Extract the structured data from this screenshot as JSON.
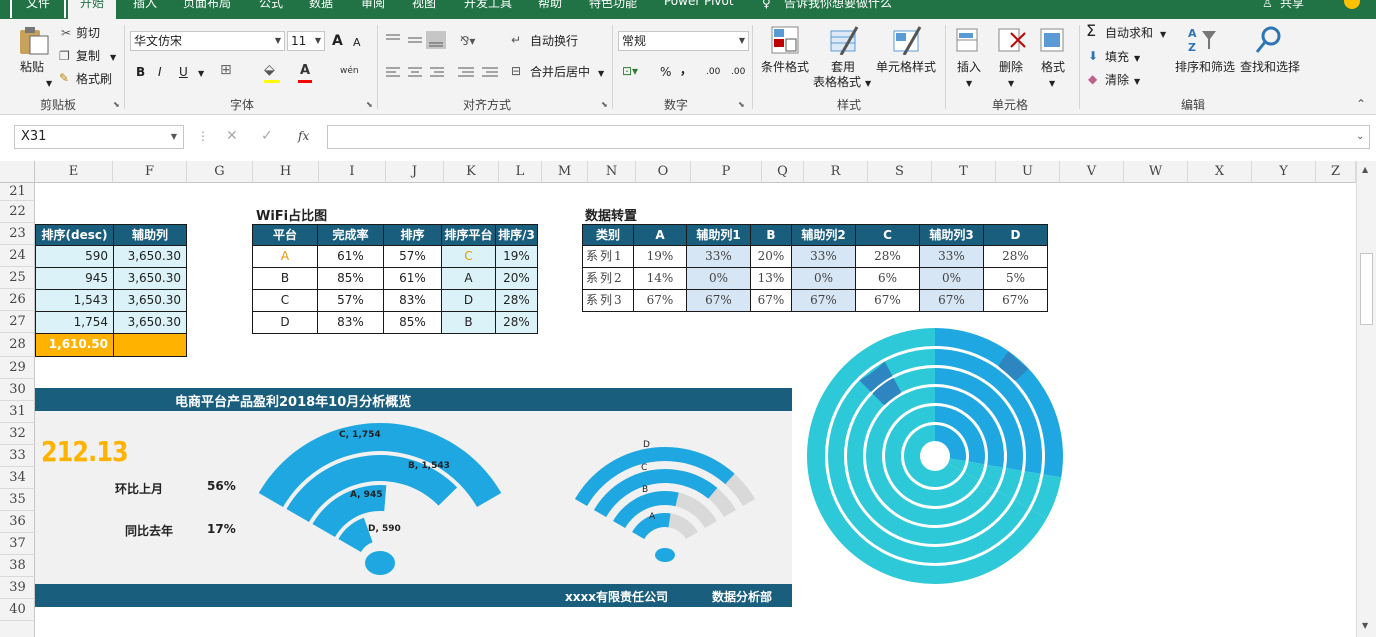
{
  "tabs": {
    "file": "文件",
    "home": "开始",
    "insert": "插入",
    "layout": "页面布局",
    "formulas": "公式",
    "data": "数据",
    "review": "审阅",
    "view": "视图",
    "developer": "开发工具",
    "help": "帮助",
    "special": "特色功能",
    "powerpivot": "Power Pivot",
    "tell": "告诉我你想要做什么",
    "share": "共享"
  },
  "ribbon": {
    "paste": "粘贴",
    "cut": "剪切",
    "copy": "复制",
    "format_painter": "格式刷",
    "clipboard": "剪贴板",
    "font_name": "华文仿宋",
    "font_size": "11",
    "font_group": "字体",
    "wrap": "自动换行",
    "merge": "合并后居中",
    "align_group": "对齐方式",
    "num_format": "常规",
    "num_group": "数字",
    "cond_format": "条件格式",
    "table_format_1": "套用",
    "table_format_2": "表格格式",
    "cell_style": "单元格样式",
    "style_group": "样式",
    "insert": "插入",
    "delete": "删除",
    "format": "格式",
    "cells_group": "单元格",
    "autosum": "自动求和",
    "fill": "填充",
    "clear": "清除",
    "sort_filter": "排序和筛选",
    "find": "查找和选择",
    "edit_group": "编辑",
    "bold": "B",
    "italic": "I",
    "underline": "U",
    "bigA": "A",
    "smallA": "A",
    "wen": "wén",
    "pct": "%",
    "comma": "，",
    "dec_inc": ".00",
    "dec_dec": ".00"
  },
  "namebox": "X31",
  "fx": "fx",
  "columns": [
    "E",
    "F",
    "G",
    "H",
    "I",
    "J",
    "K",
    "L",
    "M",
    "N",
    "O",
    "P",
    "Q",
    "R",
    "S",
    "T",
    "U",
    "V",
    "W",
    "X",
    "Y",
    "Z"
  ],
  "rows": [
    "21",
    "22",
    "23",
    "24",
    "25",
    "26",
    "27",
    "28",
    "29",
    "30",
    "31",
    "32",
    "33",
    "34",
    "35",
    "36",
    "37",
    "38",
    "39",
    "40"
  ],
  "t1": {
    "h1": "排序(desc)",
    "h2": "辅助列",
    "r1a": "590",
    "r1b": "3,650.30",
    "r2a": "945",
    "r2b": "3,650.30",
    "r3a": "1,543",
    "r3b": "3,650.30",
    "r4a": "1,754",
    "r4b": "3,650.30",
    "total": "1,610.50"
  },
  "t2": {
    "title": "WiFi占比图",
    "h1": "平台",
    "h2": "完成率",
    "h3": "排序",
    "h4": "排序平台",
    "h5": "排序/3",
    "rows": [
      [
        "A",
        "61%",
        "57%",
        "C",
        "19%"
      ],
      [
        "B",
        "85%",
        "61%",
        "A",
        "20%"
      ],
      [
        "C",
        "57%",
        "83%",
        "D",
        "28%"
      ],
      [
        "D",
        "83%",
        "85%",
        "B",
        "28%"
      ]
    ]
  },
  "t3": {
    "title": "数据转置",
    "h": [
      "类别",
      "A",
      "辅助列1",
      "B",
      "辅助列2",
      "C",
      "辅助列3",
      "D"
    ],
    "rows": [
      [
        "系列1",
        "19%",
        "33%",
        "20%",
        "33%",
        "28%",
        "33%",
        "28%"
      ],
      [
        "系列2",
        "14%",
        "0%",
        "13%",
        "0%",
        "6%",
        "0%",
        "5%"
      ],
      [
        "系列3",
        "67%",
        "67%",
        "67%",
        "67%",
        "67%",
        "67%",
        "67%"
      ]
    ]
  },
  "dash": {
    "title": "电商平台产品盈利2018年10月分析概览",
    "big": "212.13",
    "mom_label": "环比上月",
    "mom_value": "56%",
    "yoy_label": "同比去年",
    "yoy_value": "17%",
    "company": "xxxx有限责任公司",
    "dept": "数据分析部"
  },
  "chart_data": [
    {
      "type": "bar",
      "categories": [
        "C",
        "B",
        "A",
        "D"
      ],
      "values": [
        1754,
        1543,
        945,
        590
      ],
      "labels": [
        "C, 1,754",
        "B, 1,543",
        "A, 945",
        "D, 590"
      ]
    },
    {
      "type": "bar",
      "categories": [
        "D",
        "C",
        "B",
        "A"
      ],
      "values": [
        85,
        83,
        61,
        57
      ]
    },
    {
      "type": "pie",
      "series": [
        {
          "values": [
            19,
            33,
            20,
            33,
            28,
            33,
            28
          ]
        },
        {
          "values": [
            14,
            0,
            13,
            0,
            6,
            0,
            5
          ]
        },
        {
          "values": [
            67,
            67,
            67,
            67,
            67,
            67,
            67
          ]
        }
      ]
    }
  ],
  "colors": {
    "excel_green": "#217346",
    "header_teal": "#1a5e7e",
    "light_blue": "#dbf3f8",
    "orange": "#ffb300",
    "chart_blue": "#1ea7e1",
    "chart_cyan": "#2ec9d8",
    "gold_text": "#ffb300"
  }
}
